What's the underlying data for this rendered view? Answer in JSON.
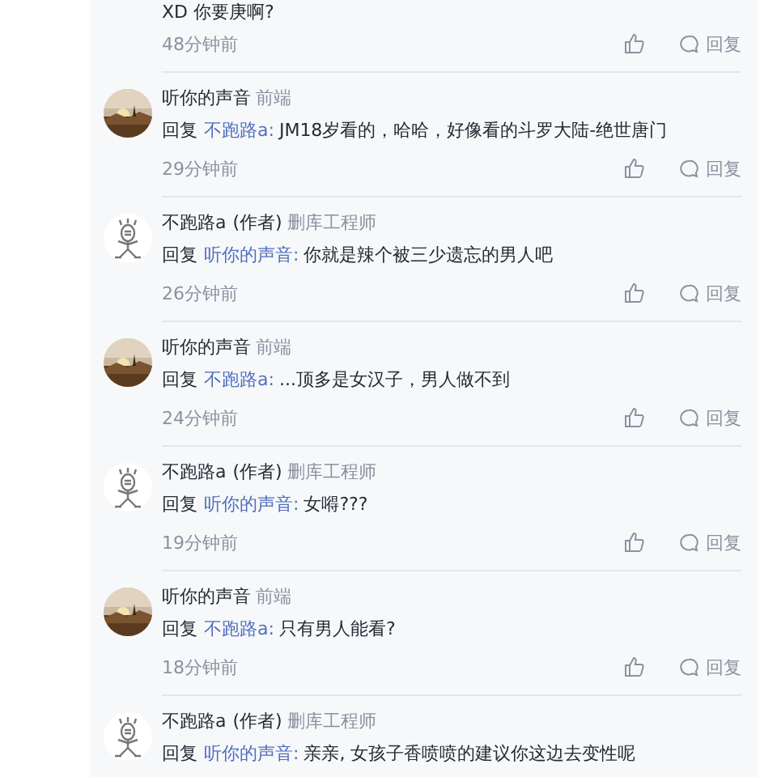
{
  "partial_comment": {
    "text": "XD 你要庚啊?",
    "time": "48分钟前",
    "reply_label": "回复"
  },
  "comments": [
    {
      "name": "听你的声音",
      "title": "前端",
      "reply_prefix": "回复",
      "reply_to": "不跑路a:",
      "text": "JM18岁看的，哈哈，好像看的斗罗大陆-绝世唐门",
      "time": "29分钟前",
      "reply_label": "回复"
    },
    {
      "kind": "sketch",
      "name": "不跑路a",
      "author_tag": "(作者)",
      "title": "删库工程师",
      "reply_prefix": "回复",
      "reply_to": "听你的声音:",
      "text": "你就是辣个被三少遗忘的男人吧",
      "time": "26分钟前",
      "reply_label": "回复"
    },
    {
      "name": "听你的声音",
      "title": "前端",
      "reply_prefix": "回复",
      "reply_to": "不跑路a:",
      "text": "...顶多是女汉子，男人做不到",
      "time": "24分钟前",
      "reply_label": "回复"
    },
    {
      "kind": "sketch",
      "name": "不跑路a",
      "author_tag": "(作者)",
      "title": "删库工程师",
      "reply_prefix": "回复",
      "reply_to": "听你的声音:",
      "text": "女嘚???",
      "time": "19分钟前",
      "reply_label": "回复"
    },
    {
      "name": "听你的声音",
      "title": "前端",
      "reply_prefix": "回复",
      "reply_to": "不跑路a:",
      "text": "只有男人能看?",
      "time": "18分钟前",
      "reply_label": "回复"
    },
    {
      "kind": "sketch",
      "name": "不跑路a",
      "author_tag": "(作者)",
      "title": "删库工程师",
      "reply_prefix": "回复",
      "reply_to": "听你的声音:",
      "text": "亲亲, 女孩子香喷喷的建议你这边去变性呢"
    }
  ]
}
